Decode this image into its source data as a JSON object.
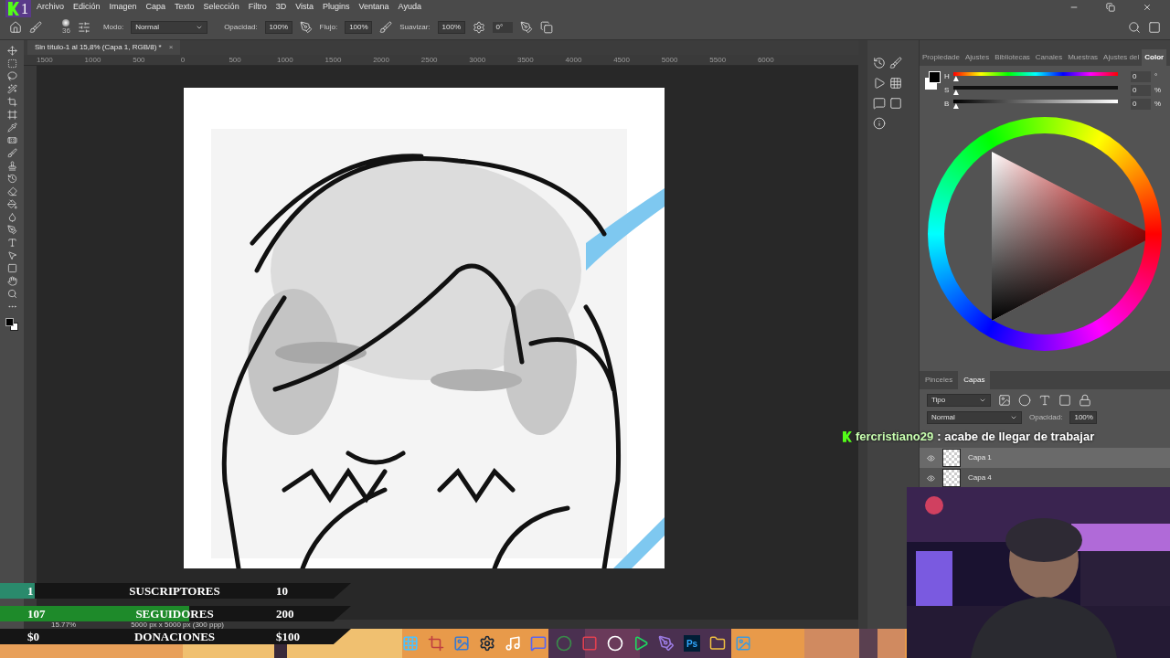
{
  "overlay_logo": "1",
  "menu": [
    "Archivo",
    "Edición",
    "Imagen",
    "Capa",
    "Texto",
    "Selección",
    "Filtro",
    "3D",
    "Vista",
    "Plugins",
    "Ventana",
    "Ayuda"
  ],
  "options_bar": {
    "brush_size": "36",
    "mode_label": "Modo:",
    "mode": "Normal",
    "opacity_label": "Opacidad:",
    "opacity": "100%",
    "flow_label": "Flujo:",
    "flow": "100%",
    "smoothing_label": "Suavizar:",
    "smoothing": "100%",
    "angle": "0°"
  },
  "document_tab": {
    "title": "Sin título-1 al 15,8% (Capa 1, RGB/8) *",
    "close": "×"
  },
  "ruler": [
    "1500",
    "1000",
    "500",
    "0",
    "500",
    "1000",
    "1500",
    "2000",
    "2500",
    "3000",
    "3500",
    "4000",
    "4500",
    "5000",
    "5500",
    "6000"
  ],
  "status_bar": {
    "zoom": "15.77%",
    "doc_size": "5000 px x 5000 px (300 ppp)"
  },
  "color_panel": {
    "tabs": [
      {
        "label": "Propiedade",
        "selected": false
      },
      {
        "label": "Ajustes",
        "selected": false
      },
      {
        "label": "Bibliotecas",
        "selected": false
      },
      {
        "label": "Canales",
        "selected": false
      },
      {
        "label": "Muestras",
        "selected": false
      },
      {
        "label": "Ajustes del",
        "selected": false
      },
      {
        "label": "Color",
        "selected": true
      }
    ],
    "sliders": [
      {
        "kind": "hue",
        "label": "H",
        "value": "0",
        "unit": "°",
        "level": 0
      },
      {
        "kind": "saturation",
        "label": "S",
        "value": "0",
        "unit": "%",
        "level": 0
      },
      {
        "kind": "brightness",
        "label": "B",
        "value": "0",
        "unit": "%",
        "level": 0
      }
    ]
  },
  "layers_panel": {
    "tabs": [
      {
        "label": "Pinceles",
        "selected": false
      },
      {
        "label": "Capas",
        "selected": true
      }
    ],
    "filter": "Tipo",
    "blend_mode": "Normal",
    "opacity_label": "Opacidad:",
    "opacity": "100%",
    "layers": [
      {
        "name": "Capa 1",
        "selected": true,
        "visible": true
      },
      {
        "name": "Capa 4",
        "selected": false,
        "visible": true
      }
    ]
  },
  "chat": {
    "user": "fercristiano29",
    "message": ": acabe de llegar de trabajar"
  },
  "goals": [
    {
      "current": "1",
      "label": "SUSCRIPTORES",
      "target": "10",
      "level": 0.1,
      "color": "#2a8a6c"
    },
    {
      "current": "107",
      "label": "SEGUIDORES",
      "target": "200",
      "level": 0.54,
      "color": "#1e8a2a"
    },
    {
      "current": "$0",
      "label": "DONACIONES",
      "target": "$100",
      "level": 0
    }
  ],
  "taskbar": {
    "photoshop_label": "Ps"
  }
}
